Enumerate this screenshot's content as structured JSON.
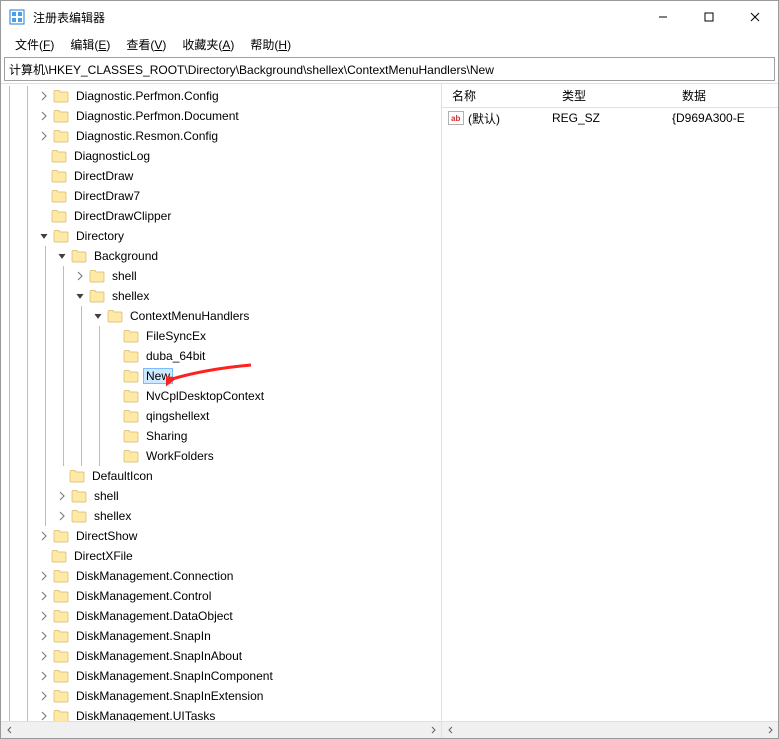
{
  "window": {
    "title": "注册表编辑器"
  },
  "menu": {
    "file": "文件(F)",
    "edit": "编辑(E)",
    "view": "查看(V)",
    "fav": "收藏夹(A)",
    "help": "帮助(H)"
  },
  "addressbar": {
    "value": "计算机\\HKEY_CLASSES_ROOT\\Directory\\Background\\shellex\\ContextMenuHandlers\\New"
  },
  "columns": {
    "name": "名称",
    "type": "类型",
    "data": "数据"
  },
  "value_row": {
    "name": "(默认)",
    "type": "REG_SZ",
    "data": "{D969A300-E"
  },
  "tree": [
    {
      "indent": 2,
      "expander": "closed",
      "label": "Diagnostic.Perfmon.Config"
    },
    {
      "indent": 2,
      "expander": "closed",
      "label": "Diagnostic.Perfmon.Document"
    },
    {
      "indent": 2,
      "expander": "closed",
      "label": "Diagnostic.Resmon.Config"
    },
    {
      "indent": 2,
      "expander": "none",
      "label": "DiagnosticLog"
    },
    {
      "indent": 2,
      "expander": "none",
      "label": "DirectDraw"
    },
    {
      "indent": 2,
      "expander": "none",
      "label": "DirectDraw7"
    },
    {
      "indent": 2,
      "expander": "none",
      "label": "DirectDrawClipper"
    },
    {
      "indent": 2,
      "expander": "open",
      "label": "Directory"
    },
    {
      "indent": 3,
      "expander": "open",
      "label": "Background"
    },
    {
      "indent": 4,
      "expander": "closed",
      "label": "shell"
    },
    {
      "indent": 4,
      "expander": "open",
      "label": "shellex"
    },
    {
      "indent": 5,
      "expander": "open",
      "label": "ContextMenuHandlers"
    },
    {
      "indent": 6,
      "expander": "none",
      "label": " FileSyncEx"
    },
    {
      "indent": 6,
      "expander": "none",
      "label": "duba_64bit"
    },
    {
      "indent": 6,
      "expander": "none",
      "label": "New",
      "selected": true,
      "arrow": true
    },
    {
      "indent": 6,
      "expander": "none",
      "label": "NvCplDesktopContext"
    },
    {
      "indent": 6,
      "expander": "none",
      "label": "qingshellext"
    },
    {
      "indent": 6,
      "expander": "none",
      "label": "Sharing"
    },
    {
      "indent": 6,
      "expander": "none",
      "label": "WorkFolders"
    },
    {
      "indent": 3,
      "expander": "none",
      "label": "DefaultIcon"
    },
    {
      "indent": 3,
      "expander": "closed",
      "label": "shell"
    },
    {
      "indent": 3,
      "expander": "closed",
      "label": "shellex"
    },
    {
      "indent": 2,
      "expander": "closed",
      "label": "DirectShow"
    },
    {
      "indent": 2,
      "expander": "none",
      "label": "DirectXFile"
    },
    {
      "indent": 2,
      "expander": "closed",
      "label": "DiskManagement.Connection"
    },
    {
      "indent": 2,
      "expander": "closed",
      "label": "DiskManagement.Control"
    },
    {
      "indent": 2,
      "expander": "closed",
      "label": "DiskManagement.DataObject"
    },
    {
      "indent": 2,
      "expander": "closed",
      "label": "DiskManagement.SnapIn"
    },
    {
      "indent": 2,
      "expander": "closed",
      "label": "DiskManagement.SnapInAbout"
    },
    {
      "indent": 2,
      "expander": "closed",
      "label": "DiskManagement.SnapInComponent"
    },
    {
      "indent": 2,
      "expander": "closed",
      "label": "DiskManagement.SnapInExtension"
    },
    {
      "indent": 2,
      "expander": "closed",
      "label": "DiskManagement.UITasks"
    }
  ]
}
